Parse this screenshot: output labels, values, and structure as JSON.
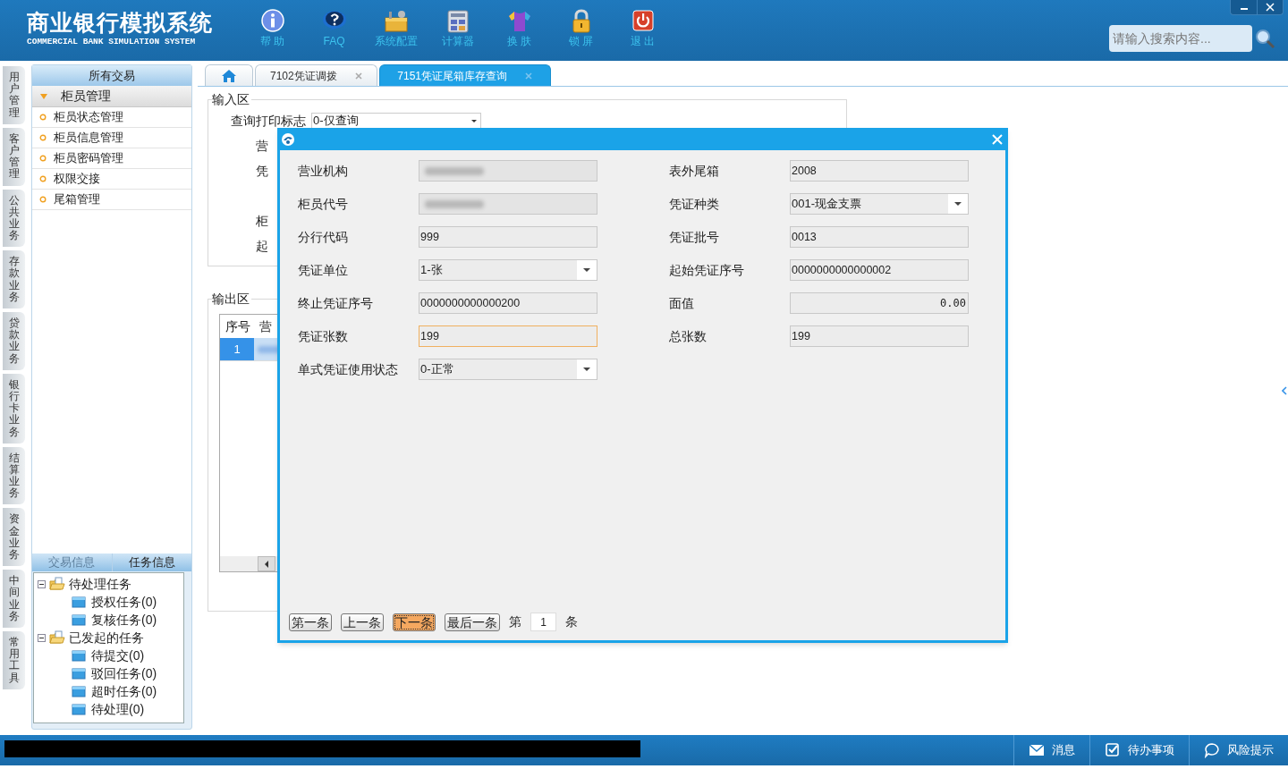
{
  "header": {
    "title": "商业银行模拟系统",
    "subtitle": "COMMERCIAL BANK SIMULATION SYSTEM",
    "search": {
      "placeholder": "请输入搜索内容..."
    }
  },
  "toolbar": [
    "帮 助",
    "FAQ",
    "系统配置",
    "计算器",
    "换 肤",
    "锁 屏",
    "退 出"
  ],
  "side_tabs": [
    "用户管理",
    "客户管理",
    "公共业务",
    "存款业务",
    "贷款业务",
    "银行卡业务",
    "结算业务",
    "资金业务",
    "中间业务",
    "常用工具"
  ],
  "sidebar": {
    "title": "所有交易",
    "group": {
      "label": "柜员管理",
      "expanded": true,
      "items": [
        "柜员状态管理",
        "柜员信息管理",
        "柜员密码管理",
        "权限交接",
        "尾箱管理"
      ]
    }
  },
  "info_panel": {
    "tabs": [
      {
        "label": "交易信息",
        "selected": false
      },
      {
        "label": "任务信息",
        "selected": true
      }
    ],
    "tree": [
      {
        "label": "待处理任务",
        "expanded": true,
        "children": [
          {
            "label": "授权任务(0)"
          },
          {
            "label": "复核任务(0)"
          }
        ]
      },
      {
        "label": "已发起的任务",
        "expanded": true,
        "children": [
          {
            "label": "待提交(0)"
          },
          {
            "label": "驳回任务(0)"
          },
          {
            "label": "超时任务(0)"
          },
          {
            "label": "待处理(0)"
          }
        ]
      }
    ]
  },
  "tabs": [
    {
      "kind": "home",
      "selected": false
    },
    {
      "kind": "page",
      "label": "7102凭证调拨",
      "selected": false
    },
    {
      "kind": "page",
      "label": "7151凭证尾箱库存查询",
      "selected": true
    }
  ],
  "input_area": {
    "title": "输入区",
    "rows": [
      {
        "label": "查询打印标志",
        "value": "0-仅查询"
      },
      {
        "label": "营"
      },
      {
        "label": "凭"
      },
      {
        "label": "柜"
      },
      {
        "label": "起"
      }
    ]
  },
  "output_area": {
    "title": "输出区",
    "columns": [
      "序号",
      "营"
    ],
    "rows": [
      {
        "index": "1",
        "selected": true
      }
    ]
  },
  "dialog": {
    "fields": [
      {
        "label": "营业机构",
        "kind": "redacted"
      },
      {
        "label": "表外尾箱",
        "kind": "text",
        "value": "2008"
      },
      {
        "label": "柜员代号",
        "kind": "redacted"
      },
      {
        "label": "凭证种类",
        "kind": "select",
        "value": "001-现金支票"
      },
      {
        "label": "分行代码",
        "kind": "text",
        "value": "999"
      },
      {
        "label": "凭证批号",
        "kind": "text",
        "value": "0013"
      },
      {
        "label": "凭证单位",
        "kind": "select",
        "value": "1-张"
      },
      {
        "label": "起始凭证序号",
        "kind": "text",
        "value": "0000000000000002"
      },
      {
        "label": "终止凭证序号",
        "kind": "text",
        "value": "0000000000000200"
      },
      {
        "label": "面值",
        "kind": "amount",
        "value": "0.00"
      },
      {
        "label": "凭证张数",
        "kind": "text",
        "value": "199",
        "focused": true
      },
      {
        "label": "总张数",
        "kind": "text",
        "value": "199"
      },
      {
        "label": "单式凭证使用状态",
        "kind": "select",
        "value": "0-正常"
      }
    ],
    "pager": {
      "buttons": [
        {
          "label": "第一条",
          "selected": false
        },
        {
          "label": "上一条",
          "selected": false
        },
        {
          "label": "下一条",
          "selected": true
        },
        {
          "label": "最后一条",
          "selected": false
        }
      ],
      "prefix": "第",
      "page": "1",
      "suffix": "条"
    }
  },
  "status_bar": [
    "消息",
    "待办事项",
    "风险提示"
  ]
}
